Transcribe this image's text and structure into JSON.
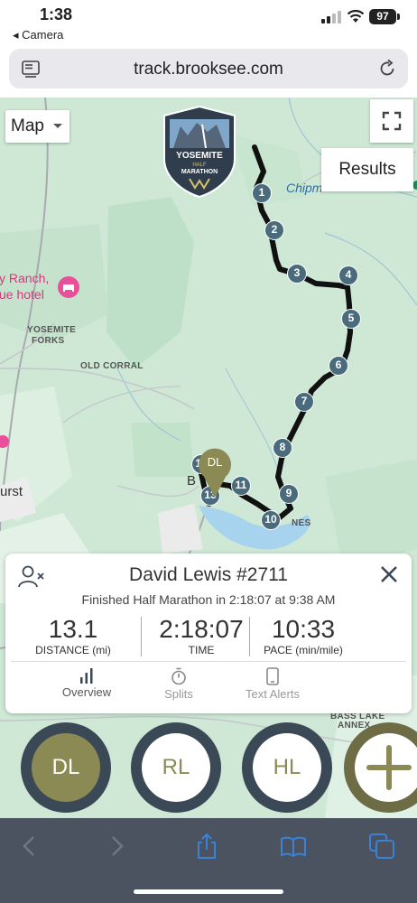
{
  "status": {
    "time": "1:38",
    "back_app": "◂ Camera",
    "battery": "97"
  },
  "browser": {
    "url": "track.brooksee.com"
  },
  "map": {
    "map_type_label": "Map",
    "results_label": "Results",
    "logo": {
      "line1": "YOSEMITE",
      "line2": "HALF",
      "line3": "MARATHON"
    },
    "labels": {
      "ranch_line1": "y Ranch,",
      "ranch_line2": "ue hotel",
      "yosemite_forks_1": "YOSEMITE",
      "yosemite_forks_2": "FORKS",
      "old_corral": "OLD CORRAL",
      "chipmunk": "Chipm",
      "urst": "urst",
      "b_town": "B",
      "pines": "NES",
      "bass_lake_1": "BASS LAKE",
      "bass_lake_2": "ANNEX"
    },
    "mile_markers": [
      "1",
      "2",
      "3",
      "4",
      "5",
      "6",
      "7",
      "8",
      "9",
      "10",
      "11",
      "12",
      "13"
    ],
    "runner_pin": "DL"
  },
  "card": {
    "runner": "David Lewis #2711",
    "status": "Finished Half Marathon in 2:18:07 at 9:38 AM",
    "stats": [
      {
        "value": "13.1",
        "label": "DISTANCE (mi)"
      },
      {
        "value": "2:18:07",
        "label": "TIME"
      },
      {
        "value": "10:33",
        "label": "PACE (min/mile)"
      }
    ],
    "tabs": [
      {
        "label": "Overview"
      },
      {
        "label": "Splits"
      },
      {
        "label": "Text Alerts"
      }
    ]
  },
  "avatars": [
    "DL",
    "RL",
    "HL"
  ],
  "colors": {
    "accent": "#8b8a55",
    "marker": "#4a6b7c",
    "ring": "#3b4856",
    "toolbar": "#4b5360",
    "link": "#3a82d8"
  }
}
